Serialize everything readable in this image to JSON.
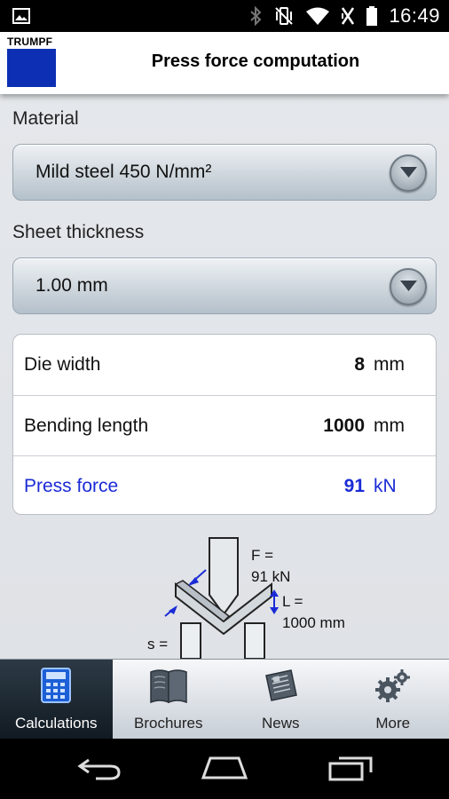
{
  "status_bar": {
    "time": "16:49",
    "icons": [
      "image-icon",
      "bluetooth-icon",
      "vibrate-icon",
      "wifi-icon",
      "battery-icon"
    ]
  },
  "header": {
    "logo_text": "TRUMPF",
    "title": "Press force computation",
    "brand_color": "#0d2fb3"
  },
  "material": {
    "label": "Material",
    "selected": "Mild steel 450 N/mm²"
  },
  "thickness": {
    "label": "Sheet thickness",
    "selected": "1.00 mm"
  },
  "results": [
    {
      "label": "Die width",
      "value": "8",
      "unit": "mm"
    },
    {
      "label": "Bending length",
      "value": "1000",
      "unit": "mm"
    },
    {
      "label": "Press force",
      "value": "91",
      "unit": "kN",
      "highlight_color": "#1a2bd6"
    }
  ],
  "diagram": {
    "force_label": "F =",
    "force_value": "91 kN",
    "length_label": "L =",
    "length_value": "1000 mm",
    "thickness_label": "s ="
  },
  "tabs": [
    {
      "label": "Calculations",
      "icon": "calculator-icon",
      "active": true
    },
    {
      "label": "Brochures",
      "icon": "book-icon",
      "active": false
    },
    {
      "label": "News",
      "icon": "newspaper-icon",
      "active": false
    },
    {
      "label": "More",
      "icon": "gears-icon",
      "active": false
    }
  ],
  "nav_bar": {
    "buttons": [
      "back-icon",
      "home-icon",
      "recent-apps-icon"
    ]
  }
}
